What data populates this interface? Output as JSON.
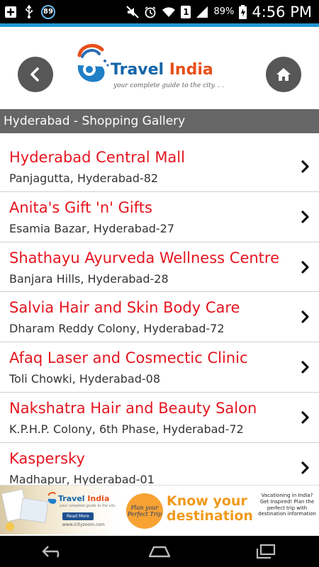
{
  "status_bar": {
    "notification_badge": "89",
    "sim_slot": "1",
    "battery_percent": "89%",
    "time": "4:56 PM"
  },
  "header": {
    "logo_title_part1": "Travel ",
    "logo_title_part2": "India",
    "logo_tagline": "your complete guide to the city. . ."
  },
  "section_title": "Hyderabad - Shopping Gallery",
  "items": [
    {
      "name": "Hyderabad Central Mall",
      "address": "Panjagutta, Hyderabad-82"
    },
    {
      "name": "Anita's Gift 'n' Gifts",
      "address": "Esamia Bazar, Hyderabad-27"
    },
    {
      "name": "Shathayu Ayurveda Wellness Centre",
      "address": "Banjara Hills, Hyderabad-28"
    },
    {
      "name": "Salvia Hair and Skin Body Care",
      "address": "Dharam Reddy Colony, Hyderabad-72"
    },
    {
      "name": "Afaq Laser and Cosmectic Clinic",
      "address": "Toli Chowki, Hyderabad-08"
    },
    {
      "name": "Nakshatra Hair and Beauty Salon",
      "address": "K.P.H.P. Colony, 6th Phase, Hyderabad-72"
    },
    {
      "name": "Kaspersky",
      "address": "Madhapur, Hyderabad-01"
    }
  ],
  "ad": {
    "logo_part1": "Travel ",
    "logo_part2": "India",
    "logo_sub": "your complete guide to the city",
    "read_more": "Read More",
    "url": "www.icityzoom.com",
    "plan_text": "Plan your Perfect Trip",
    "headline_line1": "Know your",
    "headline_line2": "destination",
    "side_text": "Vacationing in India? Get Inspired! Plan the perfect trip with destination information"
  },
  "colors": {
    "accent": "#2196d3",
    "item_title": "#e6151f",
    "section_bar": "#666666",
    "button_bg": "#575757"
  },
  "icons": {
    "back": "chevron-left-icon",
    "home": "home-icon",
    "row_arrow": "chevron-right-icon",
    "nav_back": "nav-back-icon",
    "nav_home": "nav-home-icon",
    "nav_recent": "nav-recent-apps-icon"
  }
}
